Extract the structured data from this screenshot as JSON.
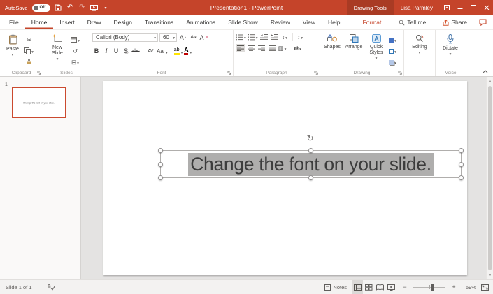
{
  "titlebar": {
    "autosave_label": "AutoSave",
    "autosave_state": "Off",
    "title": "Presentation1 - PowerPoint",
    "contextual_tab": "Drawing Tools",
    "user": "Lisa Parmley"
  },
  "tabs": {
    "items": [
      "File",
      "Home",
      "Insert",
      "Draw",
      "Design",
      "Transitions",
      "Animations",
      "Slide Show",
      "Review",
      "View",
      "Help"
    ],
    "contextual": "Format",
    "tellme": "Tell me",
    "share": "Share"
  },
  "ribbon": {
    "clipboard": {
      "group": "Clipboard",
      "paste": "Paste"
    },
    "slides": {
      "group": "Slides",
      "new": "New",
      "slide": "Slide"
    },
    "font": {
      "group": "Font",
      "name": "Calibri (Body)",
      "size": "60",
      "bold": "B",
      "italic": "I",
      "underline": "U",
      "shadow": "S",
      "strike": "abc",
      "spacing": "AV",
      "case": "Aa",
      "highlight": "ab",
      "color": "A",
      "grow": "A",
      "shrink": "A",
      "clear": "A"
    },
    "paragraph": {
      "group": "Paragraph"
    },
    "drawing": {
      "group": "Drawing",
      "shapes": "Shapes",
      "arrange": "Arrange",
      "quick_line1": "Quick",
      "quick_line2": "Styles"
    },
    "editing": {
      "label": "Editing"
    },
    "voice": {
      "group": "Voice",
      "dictate": "Dictate"
    }
  },
  "slides_panel": {
    "number": "1",
    "thumbnail_text": "Change the font on your slide."
  },
  "slide": {
    "text": "Change the font on your slide."
  },
  "statusbar": {
    "slide_info": "Slide 1 of 1",
    "notes": "Notes",
    "zoom": "59%"
  },
  "icons": {
    "undo": "↶",
    "redo": "↷",
    "rotate": "↻",
    "scissors": "✂",
    "reset": "↺",
    "section": "⊟",
    "columns": "▥",
    "smartart": "⇄",
    "line_spacing": "↕",
    "text_direction": "↕",
    "minus": "−",
    "plus": "+",
    "up": "▴",
    "down": "▾"
  }
}
